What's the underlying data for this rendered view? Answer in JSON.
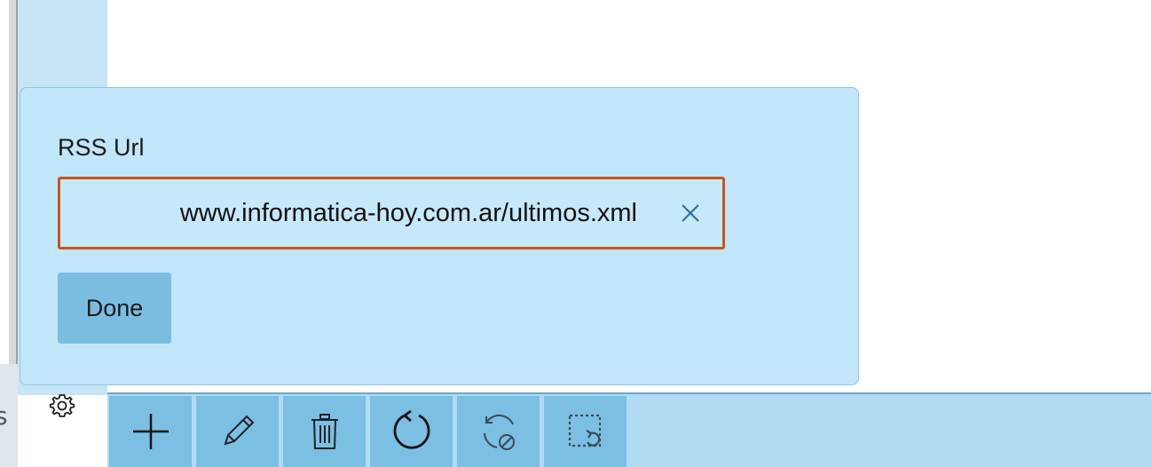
{
  "flyout": {
    "field_label": "RSS Url",
    "url_value": "www.informatica-hoy.com.ar/ultimos.xml",
    "clear_icon": "close-icon",
    "done_label": "Done"
  },
  "side": {
    "partial_text": "s",
    "settings_icon": "gear-icon"
  },
  "appbar": {
    "buttons": [
      {
        "icon": "add-icon"
      },
      {
        "icon": "edit-icon"
      },
      {
        "icon": "delete-icon"
      },
      {
        "icon": "refresh-icon"
      },
      {
        "icon": "cancel-sync-icon"
      },
      {
        "icon": "select-undo-icon"
      }
    ]
  },
  "colors": {
    "accent": "#c8541a",
    "flyout_bg": "#c1e6f9",
    "appbar_bg": "#b2daf3",
    "button_bg": "#7bbde1"
  }
}
